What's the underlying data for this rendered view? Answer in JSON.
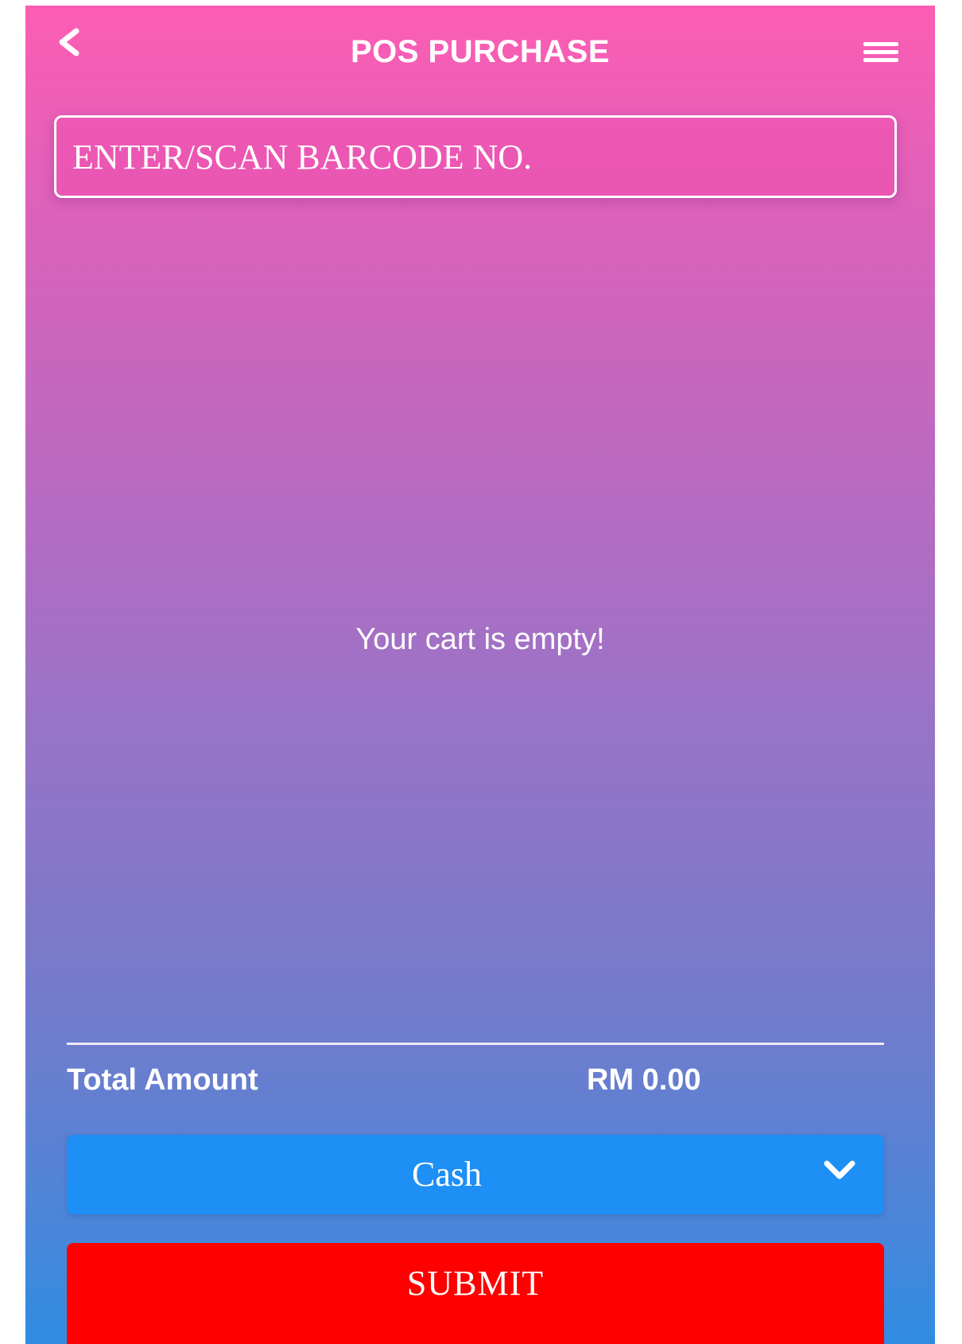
{
  "header": {
    "title": "POS PURCHASE",
    "back_icon": "chevron-left-icon",
    "menu_icon": "hamburger-menu-icon"
  },
  "barcode": {
    "placeholder": "ENTER/SCAN BARCODE NO.",
    "value": ""
  },
  "cart": {
    "empty_message": "Your cart is empty!"
  },
  "summary": {
    "total_label": "Total Amount",
    "total_value": "RM 0.00"
  },
  "payment": {
    "selected": "Cash",
    "options": [
      "Cash"
    ]
  },
  "actions": {
    "submit_label": "SUBMIT"
  },
  "colors": {
    "gradient_top": "#fd5db3",
    "gradient_mid": "#9b73c6",
    "gradient_bottom": "#2f8ce2",
    "payment_select": "#1e8ff5",
    "submit_button": "#ff0000",
    "text": "#ffffff"
  }
}
